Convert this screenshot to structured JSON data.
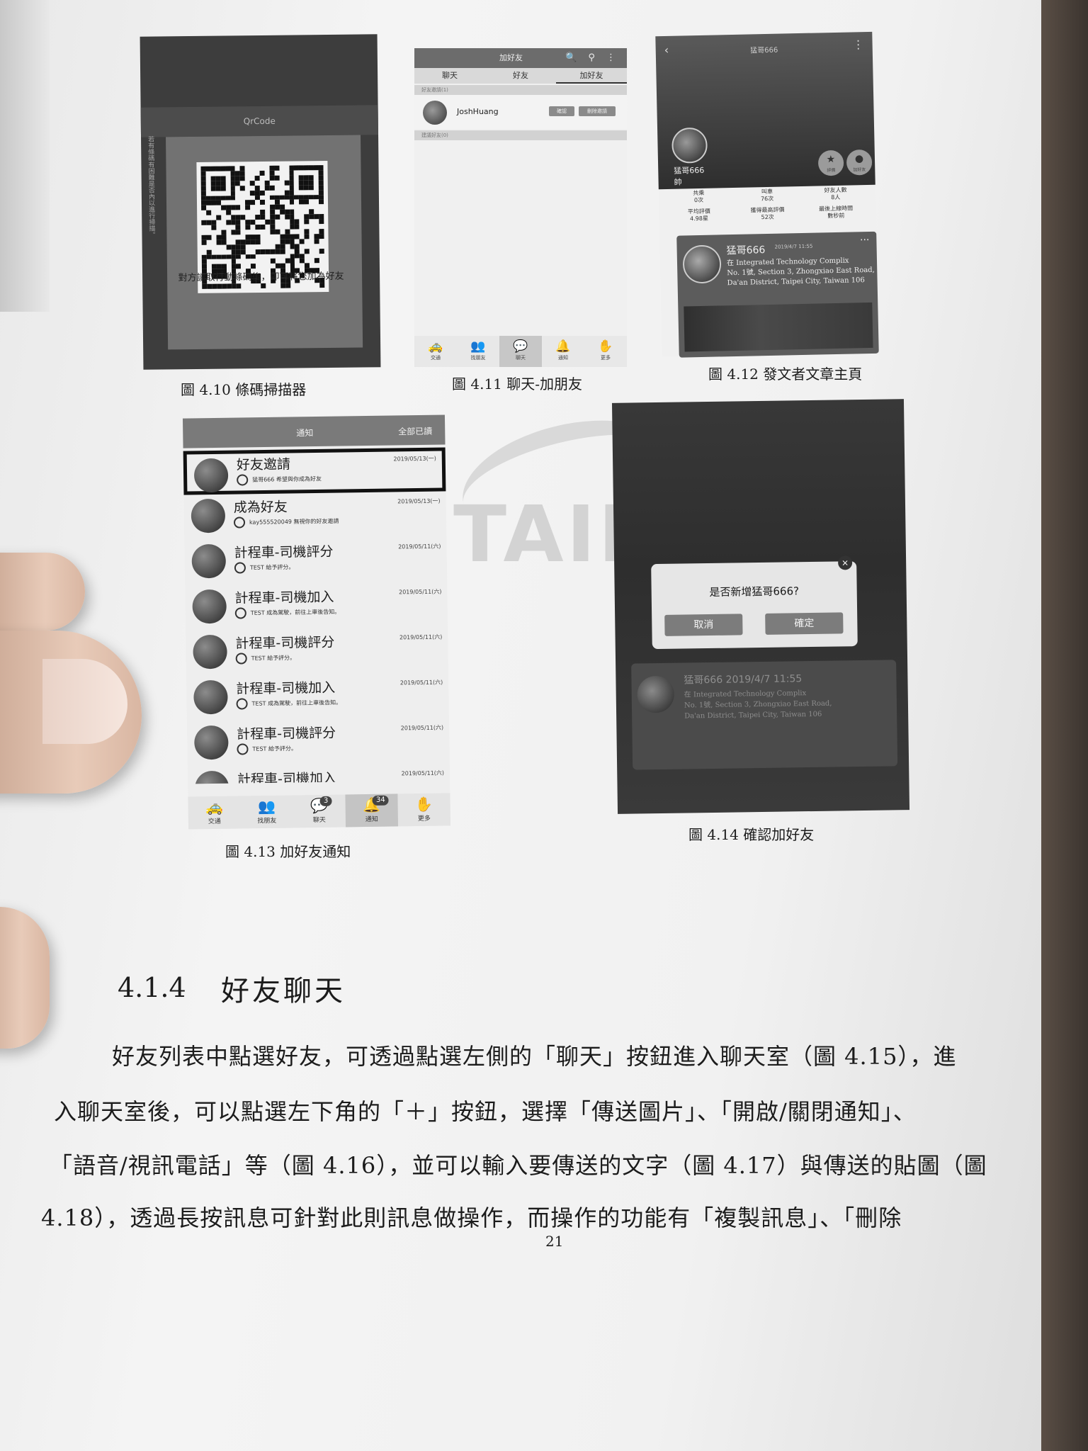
{
  "fig410": {
    "title": "QrCode",
    "hint": "對方讀取行動條碼後，即可將您加為好友",
    "side": "若有條碼有困難是否內以進行掃描。",
    "caption": "圖 4.10  條碼掃描器"
  },
  "fig411": {
    "appbar_title": "加好友",
    "appbar_icons": "🔍 ⚲ ⋮",
    "tabs": [
      "聊天",
      "好友",
      "加好友"
    ],
    "section1": "好友邀請(1)",
    "friend_name": "JoshHuang",
    "btn_confirm": "確認",
    "btn_delete": "刪除邀請",
    "section2": "建議好友(0)",
    "nav": [
      {
        "icon": "🚕",
        "label": "交通"
      },
      {
        "icon": "👥",
        "label": "找朋友"
      },
      {
        "icon": "💬",
        "label": "聊天"
      },
      {
        "icon": "🔔",
        "label": "通知"
      },
      {
        "icon": "✋",
        "label": "更多"
      }
    ],
    "caption": "圖 4.11  聊天-加朋友"
  },
  "fig412": {
    "top_title": "猛哥666",
    "user_name": "猛哥666",
    "user_tag": "帥",
    "btn_star": "評價",
    "btn_friend": "加好友",
    "stats": [
      {
        "label": "共乘",
        "value": "0次"
      },
      {
        "label": "叫車",
        "value": "76次"
      },
      {
        "label": "好友人數",
        "value": "8人"
      },
      {
        "label": "平均評價",
        "value": "4.98星"
      },
      {
        "label": "獲得最高評價",
        "value": "52次"
      },
      {
        "label": "最後上線時間",
        "value": "數秒前"
      }
    ],
    "post_name": "猛哥666",
    "post_date": "2019/4/7 11:55",
    "post_location_1": "在 Integrated Technology Complix",
    "post_location_2": "No. 1號, Section 3, Zhongxiao East Road,",
    "post_location_3": "Da'an District, Taipei City, Taiwan 106",
    "caption": "圖 4.12  發文者文章主頁"
  },
  "fig413": {
    "appbar_title": "通知",
    "appbar_action": "全部已讀",
    "items": [
      {
        "title": "好友邀請",
        "sub": "猛哥666 希望與你成為好友",
        "date": "2019/05/13(一)"
      },
      {
        "title": "成為好友",
        "sub": "kay555520049 無視你的好友邀請",
        "date": "2019/05/13(一)"
      },
      {
        "title": "計程車-司機評分",
        "sub": "TEST 給予評分。",
        "date": "2019/05/11(六)"
      },
      {
        "title": "計程車-司機加入",
        "sub": "TEST 成為駕駛，前往上車後告知。",
        "date": "2019/05/11(六)"
      },
      {
        "title": "計程車-司機評分",
        "sub": "TEST 給予評分。",
        "date": "2019/05/11(六)"
      },
      {
        "title": "計程車-司機加入",
        "sub": "TEST 成為駕駛，前往上車後告知。",
        "date": "2019/05/11(六)"
      },
      {
        "title": "計程車-司機評分",
        "sub": "TEST 給予評分。",
        "date": "2019/05/11(六)"
      },
      {
        "title": "計程車-司機加入",
        "sub": "",
        "date": "2019/05/11(六)"
      }
    ],
    "nav": [
      {
        "icon": "🚕",
        "label": "交通",
        "badge": ""
      },
      {
        "icon": "👥",
        "label": "找朋友",
        "badge": ""
      },
      {
        "icon": "💬",
        "label": "聊天",
        "badge": "3"
      },
      {
        "icon": "🔔",
        "label": "通知",
        "badge": "34"
      },
      {
        "icon": "✋",
        "label": "更多",
        "badge": ""
      }
    ],
    "caption": "圖 4.13  加好友通知"
  },
  "fig414": {
    "question": "是否新增猛哥666?",
    "cancel": "取消",
    "confirm": "確定",
    "close": "×",
    "card_name": "猛哥666  2019/4/7 11:55",
    "card_loc_1": "在 Integrated Technology Complix",
    "card_loc_2": "No. 1號, Section 3, Zhongxiao East Road,",
    "card_loc_3": "Da'an District, Taipei City, Taiwan 106",
    "caption": "圖 4.14  確認加好友"
  },
  "watermark": "TAIF",
  "section": {
    "number": "4.1.4",
    "title": "好友聊天"
  },
  "paragraph": [
    "好友列表中點選好友，可透過點選左側的「聊天」按鈕進入聊天室（圖 4.15），進",
    "入聊天室後，可以點選左下角的「＋」按鈕，選擇「傳送圖片」、「開啟/關閉通知」、",
    "「語音/視訊電話」等（圖 4.16），並可以輸入要傳送的文字（圖 4.17）與傳送的貼圖（圖",
    "4.18），透過長按訊息可針對此則訊息做操作，而操作的功能有「複製訊息」、「刪除"
  ],
  "page_number": "21"
}
